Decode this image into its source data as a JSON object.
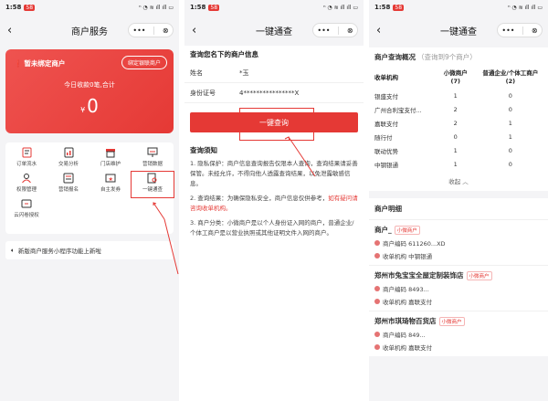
{
  "status": {
    "time": "1:58",
    "badge": "58",
    "icons": "ⁿ ◔ ≋ ıll ıll ▭"
  },
  "capsule": {
    "more": "•••",
    "close": "⊗"
  },
  "p1": {
    "title": "商户服务",
    "card_title": "暂未绑定商户",
    "bind_btn": "绑定银联商户",
    "today": "今日收款0笔,合计",
    "yen": "¥",
    "amount": "0",
    "grid": [
      {
        "label": "订单流水",
        "icon": "receipt-icon"
      },
      {
        "label": "交易分析",
        "icon": "chart-icon"
      },
      {
        "label": "门店维护",
        "icon": "store-icon"
      },
      {
        "label": "营销数据",
        "icon": "data-icon"
      },
      {
        "label": "权限管理",
        "icon": "user-icon"
      },
      {
        "label": "营销报名",
        "icon": "signup-icon"
      },
      {
        "label": "自主发券",
        "icon": "coupon-icon"
      },
      {
        "label": "一键通查",
        "icon": "search-doc-icon"
      },
      {
        "label": "云闪卷授权",
        "icon": "ticket-icon"
      }
    ],
    "notice": "新版商户服务小程序功能上新啦"
  },
  "p2": {
    "title": "一键通查",
    "section": "查询您名下的商户信息",
    "name_label": "姓名",
    "name_value": "*玉",
    "id_label": "身份证号",
    "id_value": "4****************X",
    "button": "一键查询",
    "notes_title": "查询须知",
    "note1": "1. 隐私保护：商户信息查询报告仅限本人查询，查询结果请妥善保管。未经允许，不得向他人透露查询结果，以免泄露敏感信息。",
    "note2a": "2. 查询结果：为确保隐私安全，商户信息仅供参考，",
    "note2b": "如有疑问请咨询收单机构。",
    "note3": "3. 商户分类：小微商户是以个人身份证入网的商户，普通企业/个体工商户是以营业执照或其他证明文件入网的商户。"
  },
  "p3": {
    "title": "一键通查",
    "overview": "商户查询概况",
    "overview_muted": "（查询到9个商户）",
    "headers": [
      "收单机构",
      "小微商户\n(7)",
      "普通企业/个体工商户\n(2)"
    ],
    "rows": [
      [
        "银盛支付",
        "1",
        "0"
      ],
      [
        "广州合利宝支付...",
        "2",
        "0"
      ],
      [
        "嘉联支付",
        "2",
        "1"
      ],
      [
        "随行付",
        "0",
        "1"
      ],
      [
        "联动优势",
        "1",
        "0"
      ],
      [
        "中钢银通",
        "1",
        "0"
      ]
    ],
    "collapse": "收起 ︿",
    "detail": "商户明细",
    "merchants": [
      {
        "name": "商户_",
        "tag": "小微商户",
        "code": "商户编码 611260...XD",
        "org": "收单机构 中钢银通"
      },
      {
        "name": "郑州市兔宝宝全屋定制装饰店",
        "tag": "小微商户",
        "code": "商户编码 8493...",
        "org": "收单机构 嘉联支付"
      },
      {
        "name": "郑州市琪琦物百货店",
        "tag": "小微商户",
        "code": "商户编码 849...",
        "org": "收单机构 嘉联支付"
      }
    ]
  },
  "colors": {
    "accent": "#e53935"
  }
}
